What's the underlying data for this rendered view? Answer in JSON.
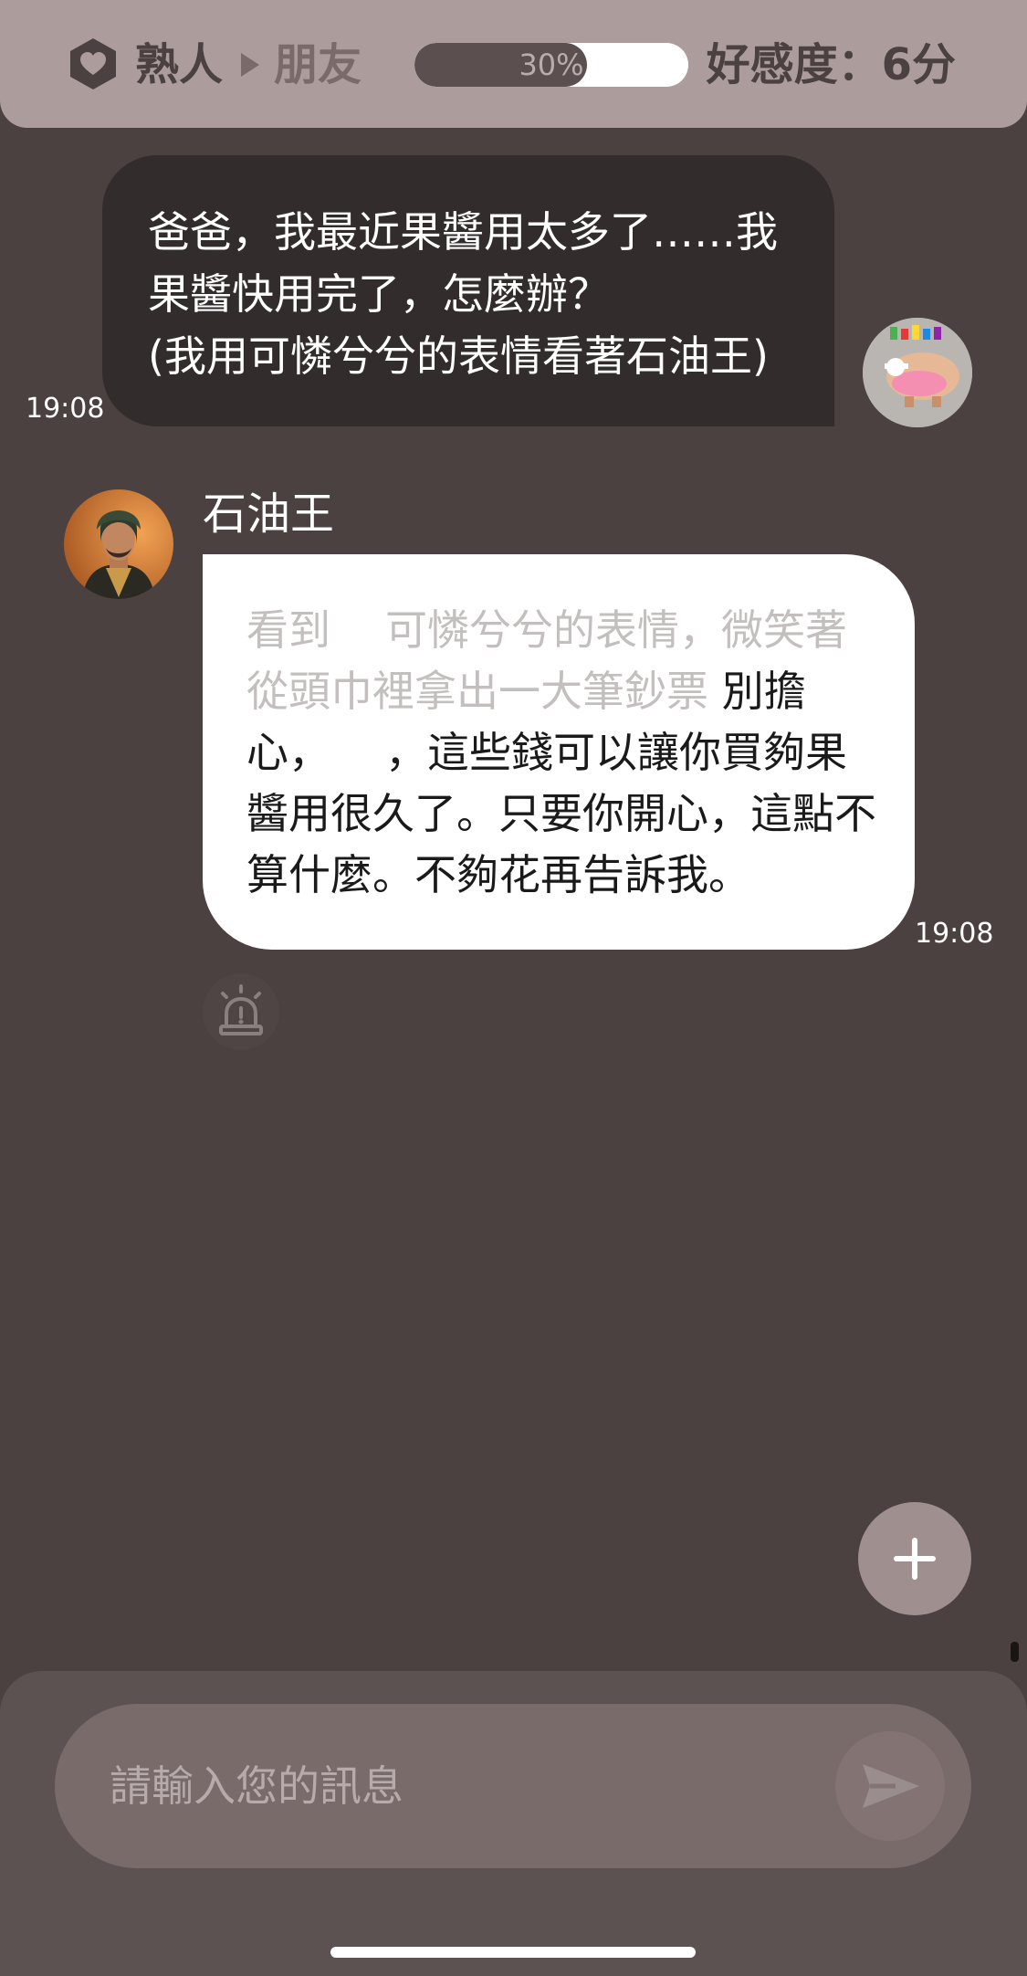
{
  "colors": {
    "background": "#4b4141",
    "header": "#ac9c9c",
    "my_bubble": "#322c2c",
    "bot_bubble": "#ffffff",
    "action_text": "#c4bfbf"
  },
  "header": {
    "level_icon": "heart-shield-icon",
    "level_from": "熟人",
    "arrow_icon": "triangle-right-icon",
    "level_to": "朋友",
    "progress_percent": 30,
    "progress_text": "30%",
    "favor_text": "好感度：6分"
  },
  "messages": {
    "mine": {
      "line1": "爸爸，我最近果醬用太多了……我",
      "line2": "果醬快用完了，怎麼辦？",
      "line3": "(我用可憐兮兮的表情看著石油王)",
      "time": "19:08",
      "avatar": "user-avatar"
    },
    "bot": {
      "name": "石油王",
      "action_part1": "看到",
      "action_part2": "可憐兮兮的表情，微笑著從頭巾裡拿出一大筆鈔票",
      "speech_part1": " 別擔心，",
      "speech_part2": "，這些錢可以讓你買夠果醬用很久了。只要你開心，這點不算什麼。不夠花再告訴我。",
      "time": "19:08",
      "avatar": "oil-king-avatar"
    }
  },
  "actions": {
    "report_icon": "alarm-siren-icon",
    "fab_icon": "plus-icon"
  },
  "composer": {
    "placeholder": "請輸入您的訊息",
    "send_icon": "send-icon"
  }
}
